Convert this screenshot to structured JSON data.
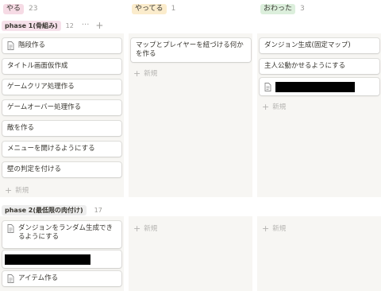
{
  "columns": [
    {
      "label": "やる",
      "count": "23",
      "color": "#f6dbe5"
    },
    {
      "label": "やってる",
      "count": "1",
      "color": "#fbeccc"
    },
    {
      "label": "おわった",
      "count": "3",
      "color": "#dcefdc"
    }
  ],
  "groups": [
    {
      "label": "phase 1(骨組み)",
      "count": "12",
      "more": "···",
      "add": "+"
    },
    {
      "label": "phase 2(最低限の肉付け)",
      "count": "17"
    }
  ],
  "group1": {
    "todo": [
      {
        "text": "階段作る",
        "icon": "page-icon"
      },
      {
        "text": "タイトル画面仮作成"
      },
      {
        "text": "ゲームクリア処理作る"
      },
      {
        "text": "ゲームオーバー処理作る"
      },
      {
        "text": "敵を作る"
      },
      {
        "text": "メニューを開けるようにする"
      },
      {
        "text": "壁の判定を付ける"
      }
    ],
    "doing": [
      {
        "text": "マップとプレイヤーを紐づける何かを作る"
      }
    ],
    "done": [
      {
        "text": "ダンジョン生成(固定マップ)"
      },
      {
        "text": "主人公動かせるようにする"
      },
      {
        "text": "",
        "icon": "page-icon",
        "redacted": true
      }
    ]
  },
  "group2": {
    "todo": [
      {
        "text": "ダンジョンをランダム生成できるようにする",
        "icon": "page-icon"
      },
      {
        "text": "",
        "redacted": true
      },
      {
        "text": "アイテム作る",
        "icon": "page-icon"
      }
    ]
  },
  "new_label": "新規",
  "plus_glyph": "+"
}
